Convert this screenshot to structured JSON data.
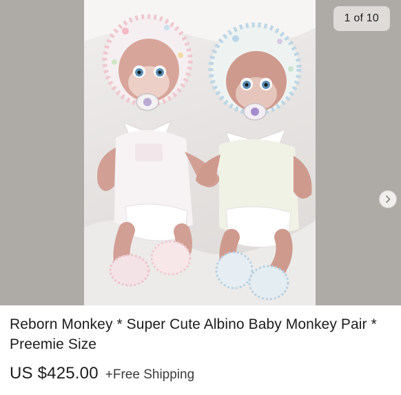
{
  "gallery": {
    "counter": "1 of 10",
    "next_icon": "chevron-right-icon",
    "image_alt": "Two reborn monkey dolls wearing crocheted bonnets, pacifiers and booties"
  },
  "listing": {
    "title": "Reborn Monkey * Super Cute Albino Baby Monkey Pair * Preemie Size",
    "price": "US $425.00",
    "shipping": "+Free Shipping"
  },
  "colors": {
    "gallery_background": "#aeaaa6",
    "text": "#1c1c1c"
  }
}
